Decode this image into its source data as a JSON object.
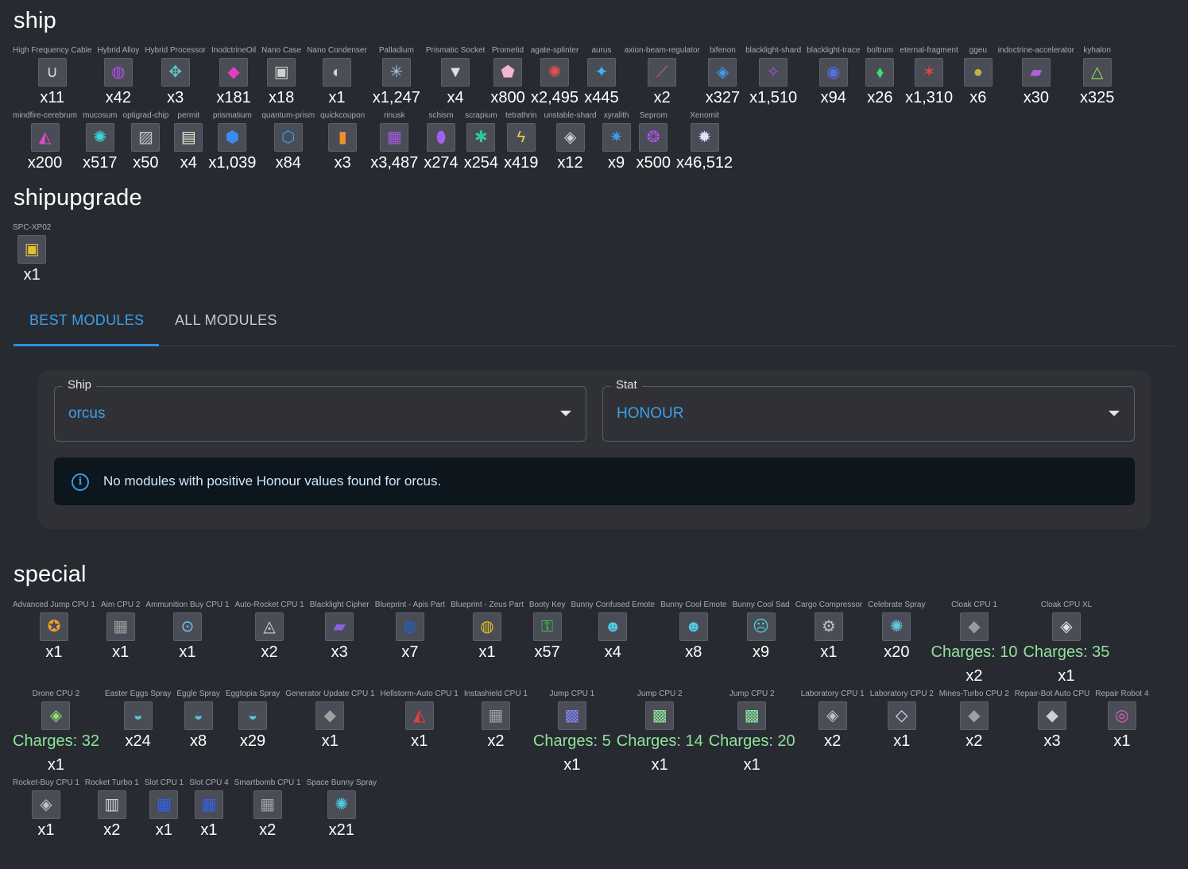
{
  "ship_section": {
    "title": "ship",
    "items": [
      {
        "label": "High Frequency Cable",
        "qty": "x11",
        "icon": "cable-icon",
        "glyph": "∪",
        "color": "#d8d8d8"
      },
      {
        "label": "Hybrid Alloy",
        "qty": "x42",
        "icon": "alloy-icon",
        "glyph": "◍",
        "color": "#b74cf0"
      },
      {
        "label": "Hybrid Processor",
        "qty": "x3",
        "icon": "processor-icon",
        "glyph": "✥",
        "color": "#5fc3c9"
      },
      {
        "label": "InodctrineOil",
        "qty": "x181",
        "icon": "oil-icon",
        "glyph": "◆",
        "color": "#e13fc0"
      },
      {
        "label": "Nano Case",
        "qty": "x18",
        "icon": "case-icon",
        "glyph": "▣",
        "color": "#cfcfcf"
      },
      {
        "label": "Nano Condenser",
        "qty": "x1",
        "icon": "condenser-icon",
        "glyph": "◐",
        "color": "#d0d0d0"
      },
      {
        "label": "Palladium",
        "qty": "x1,247",
        "icon": "palladium-icon",
        "glyph": "✳",
        "color": "#aac4dd"
      },
      {
        "label": "Prismatic Socket",
        "qty": "x4",
        "icon": "socket-icon",
        "glyph": "▼",
        "color": "#e0e0e0"
      },
      {
        "label": "Prometid",
        "qty": "x800",
        "icon": "prometid-icon",
        "glyph": "⬟",
        "color": "#f5b5d0"
      },
      {
        "label": "agate-splinter",
        "qty": "x2,495",
        "icon": "splinter-icon",
        "glyph": "✺",
        "color": "#e35050"
      },
      {
        "label": "aurus",
        "qty": "x445",
        "icon": "aurus-icon",
        "glyph": "✦",
        "color": "#3ab6f5"
      },
      {
        "label": "axion-beam-regulator",
        "qty": "x2",
        "icon": "regulator-icon",
        "glyph": "⟋",
        "color": "#d86060"
      },
      {
        "label": "bifenon",
        "qty": "x327",
        "icon": "bifenon-icon",
        "glyph": "◈",
        "color": "#3c9cf0"
      },
      {
        "label": "blacklight-shard",
        "qty": "x1,510",
        "icon": "shard-icon",
        "glyph": "✧",
        "color": "#9a55e0"
      },
      {
        "label": "blacklight-trace",
        "qty": "x94",
        "icon": "trace-icon",
        "glyph": "◉",
        "color": "#5570e0"
      },
      {
        "label": "boltrum",
        "qty": "x26",
        "icon": "boltrum-icon",
        "glyph": "⬧",
        "color": "#38e070"
      },
      {
        "label": "eternal-fragment",
        "qty": "x1,310",
        "icon": "fragment-icon",
        "glyph": "✶",
        "color": "#e04545"
      },
      {
        "label": "ggeu",
        "qty": "x6",
        "icon": "ggeu-coin-icon",
        "glyph": "●",
        "color": "#c9b24a"
      },
      {
        "label": "indoctrine-accelerator",
        "qty": "x30",
        "icon": "accelerator-icon",
        "glyph": "▰",
        "color": "#b15fe0"
      },
      {
        "label": "kyhalon",
        "qty": "x325",
        "icon": "kyhalon-icon",
        "glyph": "△",
        "color": "#8ee04a"
      },
      {
        "label": "mindfire-cerebrum",
        "qty": "x200",
        "icon": "cerebrum-icon",
        "glyph": "◭",
        "color": "#e04ac8"
      },
      {
        "label": "mucosum",
        "qty": "x517",
        "icon": "mucosum-icon",
        "glyph": "✺",
        "color": "#3ad6e0"
      },
      {
        "label": "optigrad-chip",
        "qty": "x50",
        "icon": "chip-icon",
        "glyph": "▨",
        "color": "#c0c0c0"
      },
      {
        "label": "permit",
        "qty": "x4",
        "icon": "permit-icon",
        "glyph": "▤",
        "color": "#e6e6d0"
      },
      {
        "label": "prismatium",
        "qty": "x1,039",
        "icon": "prismatium-icon",
        "glyph": "⬢",
        "color": "#3c8cf0"
      },
      {
        "label": "quantum-prism",
        "qty": "x84",
        "icon": "prism-icon",
        "glyph": "⬡",
        "color": "#3da0f0"
      },
      {
        "label": "quickcoupon",
        "qty": "x3",
        "icon": "coupon-icon",
        "glyph": "▮",
        "color": "#f0902a"
      },
      {
        "label": "rinusk",
        "qty": "x3,487",
        "icon": "rinusk-icon",
        "glyph": "▦",
        "color": "#a05ae0"
      },
      {
        "label": "schism",
        "qty": "x274",
        "icon": "schism-icon",
        "glyph": "⬮",
        "color": "#a060f0"
      },
      {
        "label": "scrapium",
        "qty": "x254",
        "icon": "scrapium-icon",
        "glyph": "✱",
        "color": "#30c8a0"
      },
      {
        "label": "tetrathrin",
        "qty": "x419",
        "icon": "tetrathrin-icon",
        "glyph": "ϟ",
        "color": "#e8d040"
      },
      {
        "label": "unstable-shard",
        "qty": "x12",
        "icon": "unstable-shard-icon",
        "glyph": "◈",
        "color": "#d0d0d0"
      },
      {
        "label": "xyralith",
        "qty": "x9",
        "icon": "xyralith-icon",
        "glyph": "✷",
        "color": "#3c9cf0"
      },
      {
        "label": "Seprom",
        "qty": "x500",
        "icon": "seprom-icon",
        "glyph": "❂",
        "color": "#b050f0"
      },
      {
        "label": "Xenomit",
        "qty": "x46,512",
        "icon": "xenomit-icon",
        "glyph": "✹",
        "color": "#e0e0ff"
      }
    ]
  },
  "shipupgrade_section": {
    "title": "shipupgrade",
    "items": [
      {
        "label": "SPC-XP02",
        "qty": "x1",
        "icon": "upgrade-chip-icon",
        "glyph": "▣",
        "color": "#e0c030"
      }
    ]
  },
  "tabs": {
    "best_modules": "BEST MODULES",
    "all_modules": "ALL MODULES"
  },
  "filters": {
    "ship_label": "Ship",
    "ship_value": "orcus",
    "stat_label": "Stat",
    "stat_value": "HONOUR"
  },
  "alert": {
    "icon_glyph": "i",
    "message": "No modules with positive Honour values found for orcus."
  },
  "special_section": {
    "title": "special",
    "items": [
      {
        "label": "Advanced Jump CPU 1",
        "qty": "x1",
        "icon": "jump-cpu-icon",
        "glyph": "✪",
        "color": "#f0a030"
      },
      {
        "label": "Aim CPU 2",
        "qty": "x1",
        "icon": "aim-cpu-icon",
        "glyph": "▦",
        "color": "#9a9a9a"
      },
      {
        "label": "Ammunition Buy CPU 1",
        "qty": "x1",
        "icon": "ammo-cpu-icon",
        "glyph": "⊙",
        "color": "#70c0f0"
      },
      {
        "label": "Auto-Rocket CPU 1",
        "qty": "x2",
        "icon": "auto-rocket-cpu-icon",
        "glyph": "◬",
        "color": "#d0d0d0"
      },
      {
        "label": "Blacklight Cipher",
        "qty": "x3",
        "icon": "cipher-icon",
        "glyph": "▰",
        "color": "#9060e0"
      },
      {
        "label": "Blueprint - Apis Part",
        "qty": "x7",
        "icon": "apis-part-icon",
        "glyph": "◍",
        "color": "#2060d0"
      },
      {
        "label": "Blueprint - Zeus Part",
        "qty": "x1",
        "icon": "zeus-part-icon",
        "glyph": "◍",
        "color": "#e0c020"
      },
      {
        "label": "Booty Key",
        "qty": "x57",
        "icon": "key-icon",
        "glyph": "⚿",
        "color": "#30d040"
      },
      {
        "label": "Bunny Confused Emote",
        "qty": "x4",
        "icon": "bunny-emote-icon",
        "glyph": "☻",
        "color": "#50c8e0"
      },
      {
        "label": "Bunny Cool Emote",
        "qty": "x8",
        "icon": "bunny-emote-icon",
        "glyph": "☻",
        "color": "#50c8e0"
      },
      {
        "label": "Bunny Cool Sad",
        "qty": "x9",
        "icon": "bunny-emote-icon",
        "glyph": "☹",
        "color": "#50c8e0"
      },
      {
        "label": "Cargo Compressor",
        "qty": "x1",
        "icon": "compressor-icon",
        "glyph": "⚙",
        "color": "#c0c0c0"
      },
      {
        "label": "Celebrate Spray",
        "qty": "x20",
        "icon": "spray-icon",
        "glyph": "✺",
        "color": "#60c8e0"
      },
      {
        "label": "Cloak CPU 1",
        "charges": "Charges: 10",
        "qty": "x2",
        "icon": "cloak-cpu-icon",
        "glyph": "◆",
        "color": "#9a9a9a"
      },
      {
        "label": "Cloak CPU XL",
        "charges": "Charges: 35",
        "qty": "x1",
        "icon": "cloak-cpu-icon",
        "glyph": "◈",
        "color": "#e0e0e0"
      },
      {
        "label": "Drone CPU 2",
        "charges": "Charges: 32",
        "qty": "x1",
        "icon": "drone-cpu-icon",
        "glyph": "◈",
        "color": "#90e070"
      },
      {
        "label": "Easter Eggs Spray",
        "qty": "x24",
        "icon": "spray-icon",
        "glyph": "◒",
        "color": "#50c8e0"
      },
      {
        "label": "Eggle Spray",
        "qty": "x8",
        "icon": "spray-icon",
        "glyph": "◒",
        "color": "#50c8e0"
      },
      {
        "label": "Eggtopia Spray",
        "qty": "x29",
        "icon": "spray-icon",
        "glyph": "◒",
        "color": "#50c8e0"
      },
      {
        "label": "Generator Update CPU 1",
        "qty": "x1",
        "icon": "generator-cpu-icon",
        "glyph": "◆",
        "color": "#a0a0a0"
      },
      {
        "label": "Hellstorm-Auto CPU 1",
        "qty": "x1",
        "icon": "hellstorm-cpu-icon",
        "glyph": "◭",
        "color": "#e04040"
      },
      {
        "label": "Instashield CPU 1",
        "qty": "x2",
        "icon": "shield-cpu-icon",
        "glyph": "▦",
        "color": "#a0a0a0"
      },
      {
        "label": "Jump CPU 1",
        "charges": "Charges: 5",
        "qty": "x1",
        "icon": "jump-cpu-icon",
        "glyph": "▩",
        "color": "#8080f0"
      },
      {
        "label": "Jump CPU 2",
        "charges": "Charges: 14",
        "qty": "x1",
        "icon": "jump-cpu-icon",
        "glyph": "▩",
        "color": "#90e0a0"
      },
      {
        "label": "Jump CPU 2",
        "charges": "Charges: 20",
        "qty": "x1",
        "icon": "jump-cpu-icon",
        "glyph": "▩",
        "color": "#90e0a0"
      },
      {
        "label": "Laboratory CPU 1",
        "qty": "x2",
        "icon": "lab-cpu-icon",
        "glyph": "◈",
        "color": "#c0c0c0"
      },
      {
        "label": "Laboratory CPU 2",
        "qty": "x1",
        "icon": "lab-cpu-icon",
        "glyph": "◇",
        "color": "#e0e0ff"
      },
      {
        "label": "Mines-Turbo CPU 2",
        "qty": "x2",
        "icon": "mines-cpu-icon",
        "glyph": "◆",
        "color": "#a0a0a0"
      },
      {
        "label": "Repair-Bot Auto CPU",
        "qty": "x3",
        "icon": "repair-cpu-icon",
        "glyph": "◆",
        "color": "#d0d0d0"
      },
      {
        "label": "Repair Robot 4",
        "qty": "x1",
        "icon": "robot-icon",
        "glyph": "◎",
        "color": "#e060c0"
      },
      {
        "label": "Rocket-Buy CPU 1",
        "qty": "x1",
        "icon": "rocket-cpu-icon",
        "glyph": "◈",
        "color": "#c0c0c0"
      },
      {
        "label": "Rocket Turbo 1",
        "qty": "x2",
        "icon": "rocket-turbo-icon",
        "glyph": "▥",
        "color": "#d0d0d0"
      },
      {
        "label": "Slot CPU 1",
        "qty": "x1",
        "icon": "slot-cpu-icon",
        "glyph": "▦",
        "color": "#3060f0"
      },
      {
        "label": "Slot CPU 4",
        "qty": "x1",
        "icon": "slot-cpu-icon",
        "glyph": "▦",
        "color": "#3060f0"
      },
      {
        "label": "Smartbomb CPU 1",
        "qty": "x2",
        "icon": "smartbomb-cpu-icon",
        "glyph": "▦",
        "color": "#a0a0a0"
      },
      {
        "label": "Space Bunny Spray",
        "qty": "x21",
        "icon": "spray-icon",
        "glyph": "✺",
        "color": "#50c8e0"
      }
    ]
  }
}
